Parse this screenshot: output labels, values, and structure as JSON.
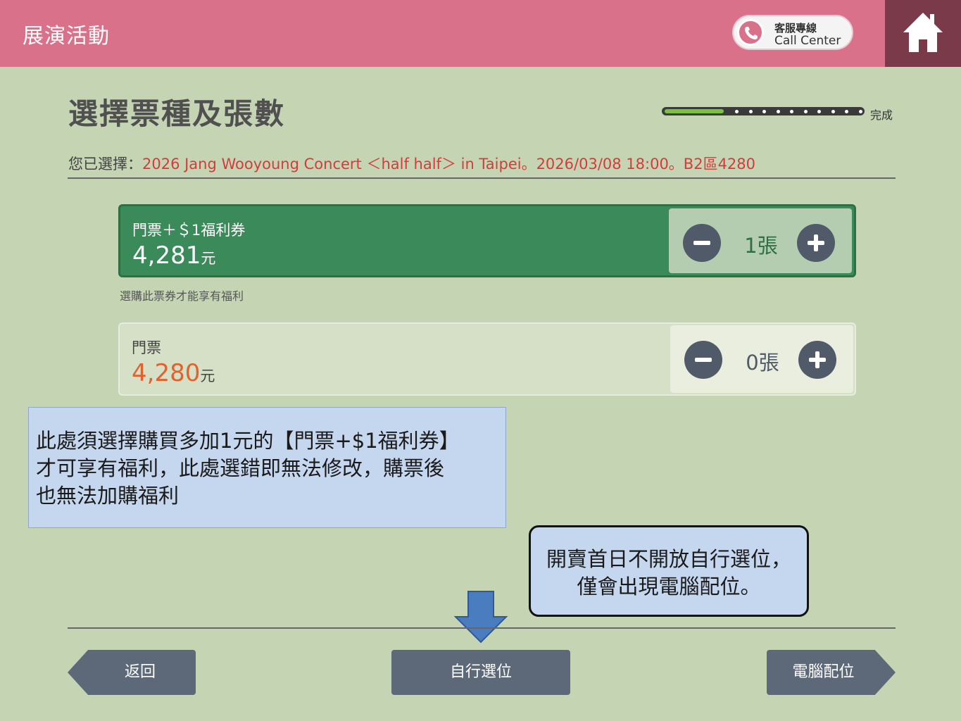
{
  "header": {
    "title": "展演活動",
    "call_center": {
      "label_zh": "客服專線",
      "label_en": "Call Center",
      "icon": "phone-icon"
    },
    "home_icon": "home-icon"
  },
  "page": {
    "title": "選擇票種及張數",
    "progress": {
      "label": "完成",
      "fraction": 0.3
    }
  },
  "selection": {
    "prefix": "您已選擇：",
    "value": "2026 Jang Wooyoung Concert ＜half half＞ in Taipei。2026/03/08 18:00。B2區4280"
  },
  "tickets": [
    {
      "name": "門票＋＄1福利券",
      "price": "4,281",
      "unit": "元",
      "quantity": "1張",
      "selected": true
    },
    {
      "name": "門票",
      "price": "4,280",
      "unit": "元",
      "quantity": "0張",
      "selected": false
    }
  ],
  "ticket_note": "選購此票券才能享有福利",
  "annotations": {
    "callout1": [
      "此處須選擇購買多加1元的【門票+$1福利券】",
      "才可享有福利，此處選錯即無法修改，購票後",
      "也無法加購福利"
    ],
    "callout2": [
      "開賣首日不開放自行選位，",
      "僅會出現電腦配位。"
    ]
  },
  "footer": {
    "back_label": "返回",
    "self_select_label": "自行選位",
    "auto_assign_label": "電腦配位"
  },
  "colors": {
    "header_bg": "#d9718a",
    "background": "#c5d5b3",
    "selected_ticket": "#3b8a5a",
    "price_highlight": "#e0632f",
    "button": "#5d6878",
    "callout_bg": "#c5d6ef",
    "arrow": "#4a7cc0"
  }
}
